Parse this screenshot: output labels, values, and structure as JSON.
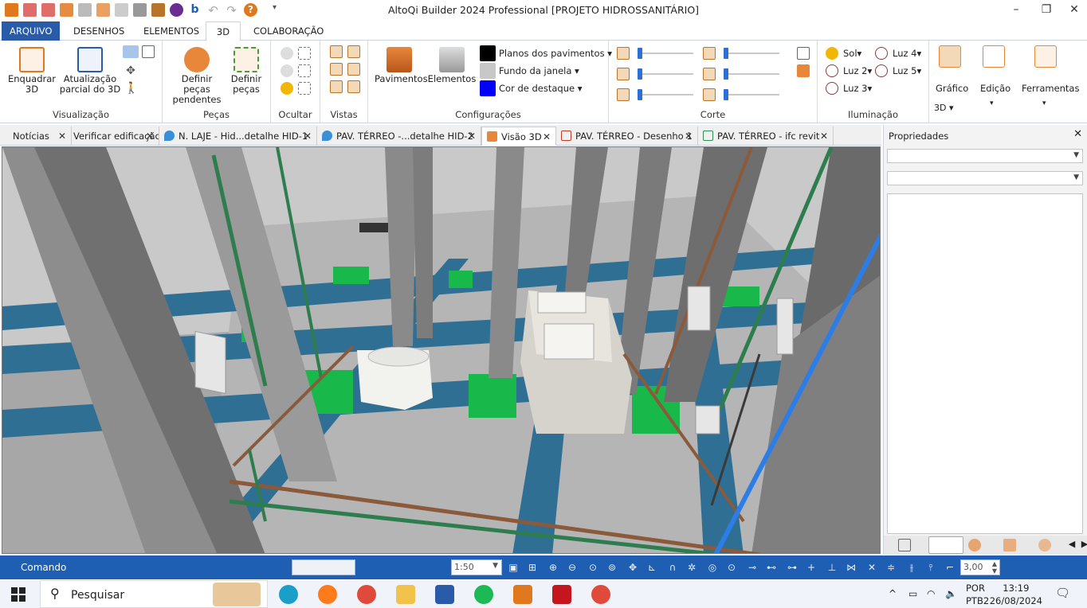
{
  "window": {
    "title": "AltoQi Builder 2024 Professional [PROJETO HIDROSSANITÁRIO]",
    "minimize": "–",
    "restore": "❐",
    "close": "✕"
  },
  "menu": {
    "tabs": [
      "ARQUIVO",
      "DESENHOS",
      "ELEMENTOS",
      "3D",
      "COLABORAÇÃO"
    ]
  },
  "ribbon": {
    "visualizacao": {
      "label": "Visualização",
      "enquadrar": "Enquadrar 3D",
      "atualizacao": "Atualização parcial do 3D"
    },
    "pecas": {
      "label": "Peças",
      "definir_pendentes": "Definir peças pendentes",
      "definir": "Definir peças"
    },
    "ocultar": {
      "label": "Ocultar"
    },
    "vistas": {
      "label": "Vistas"
    },
    "configuracoes": {
      "label": "Configurações",
      "pavimentos": "Pavimentos",
      "elementos": "Elementos",
      "planos": "Planos dos pavimentos",
      "fundo": "Fundo da janela",
      "destaque": "Cor de destaque",
      "planos_color": "#000000",
      "fundo_color": "#c8c8c8",
      "destaque_color": "#0000ff"
    },
    "corte": {
      "label": "Corte"
    },
    "iluminacao": {
      "label": "Iluminação",
      "sol": "Sol",
      "luz2": "Luz 2",
      "luz3": "Luz 3",
      "luz4": "Luz 4",
      "luz5": "Luz 5"
    },
    "grafico": {
      "label": "Gráfico",
      "sub": "3D"
    },
    "edicao": {
      "label": "Edição"
    },
    "ferramentas": {
      "label": "Ferramentas"
    }
  },
  "doc_tabs": [
    {
      "label": "Notícias",
      "icon": "none"
    },
    {
      "label": "Verificar edificação",
      "icon": "none"
    },
    {
      "label": "N. LAJE - Hid...detalhe HID-1",
      "icon": "water-drop-icon"
    },
    {
      "label": "PAV. TÉRREO -...detalhe HID-2",
      "icon": "water-drop-icon"
    },
    {
      "label": "Visão 3D",
      "icon": "cube-icon"
    },
    {
      "label": "PAV. TÉRREO - Desenho 1",
      "icon": "drawing-icon"
    },
    {
      "label": "PAV. TÉRREO - ifc revit",
      "icon": "ifc-icon"
    }
  ],
  "properties": {
    "title": "Propriedades",
    "close": "✕"
  },
  "command": {
    "label": "Comando",
    "scale": "1:50",
    "value": "3,00"
  },
  "taskbar": {
    "search_placeholder": "Pesquisar",
    "language": "POR",
    "layout": "PTB2",
    "time": "13:19",
    "date": "26/08/2024"
  }
}
